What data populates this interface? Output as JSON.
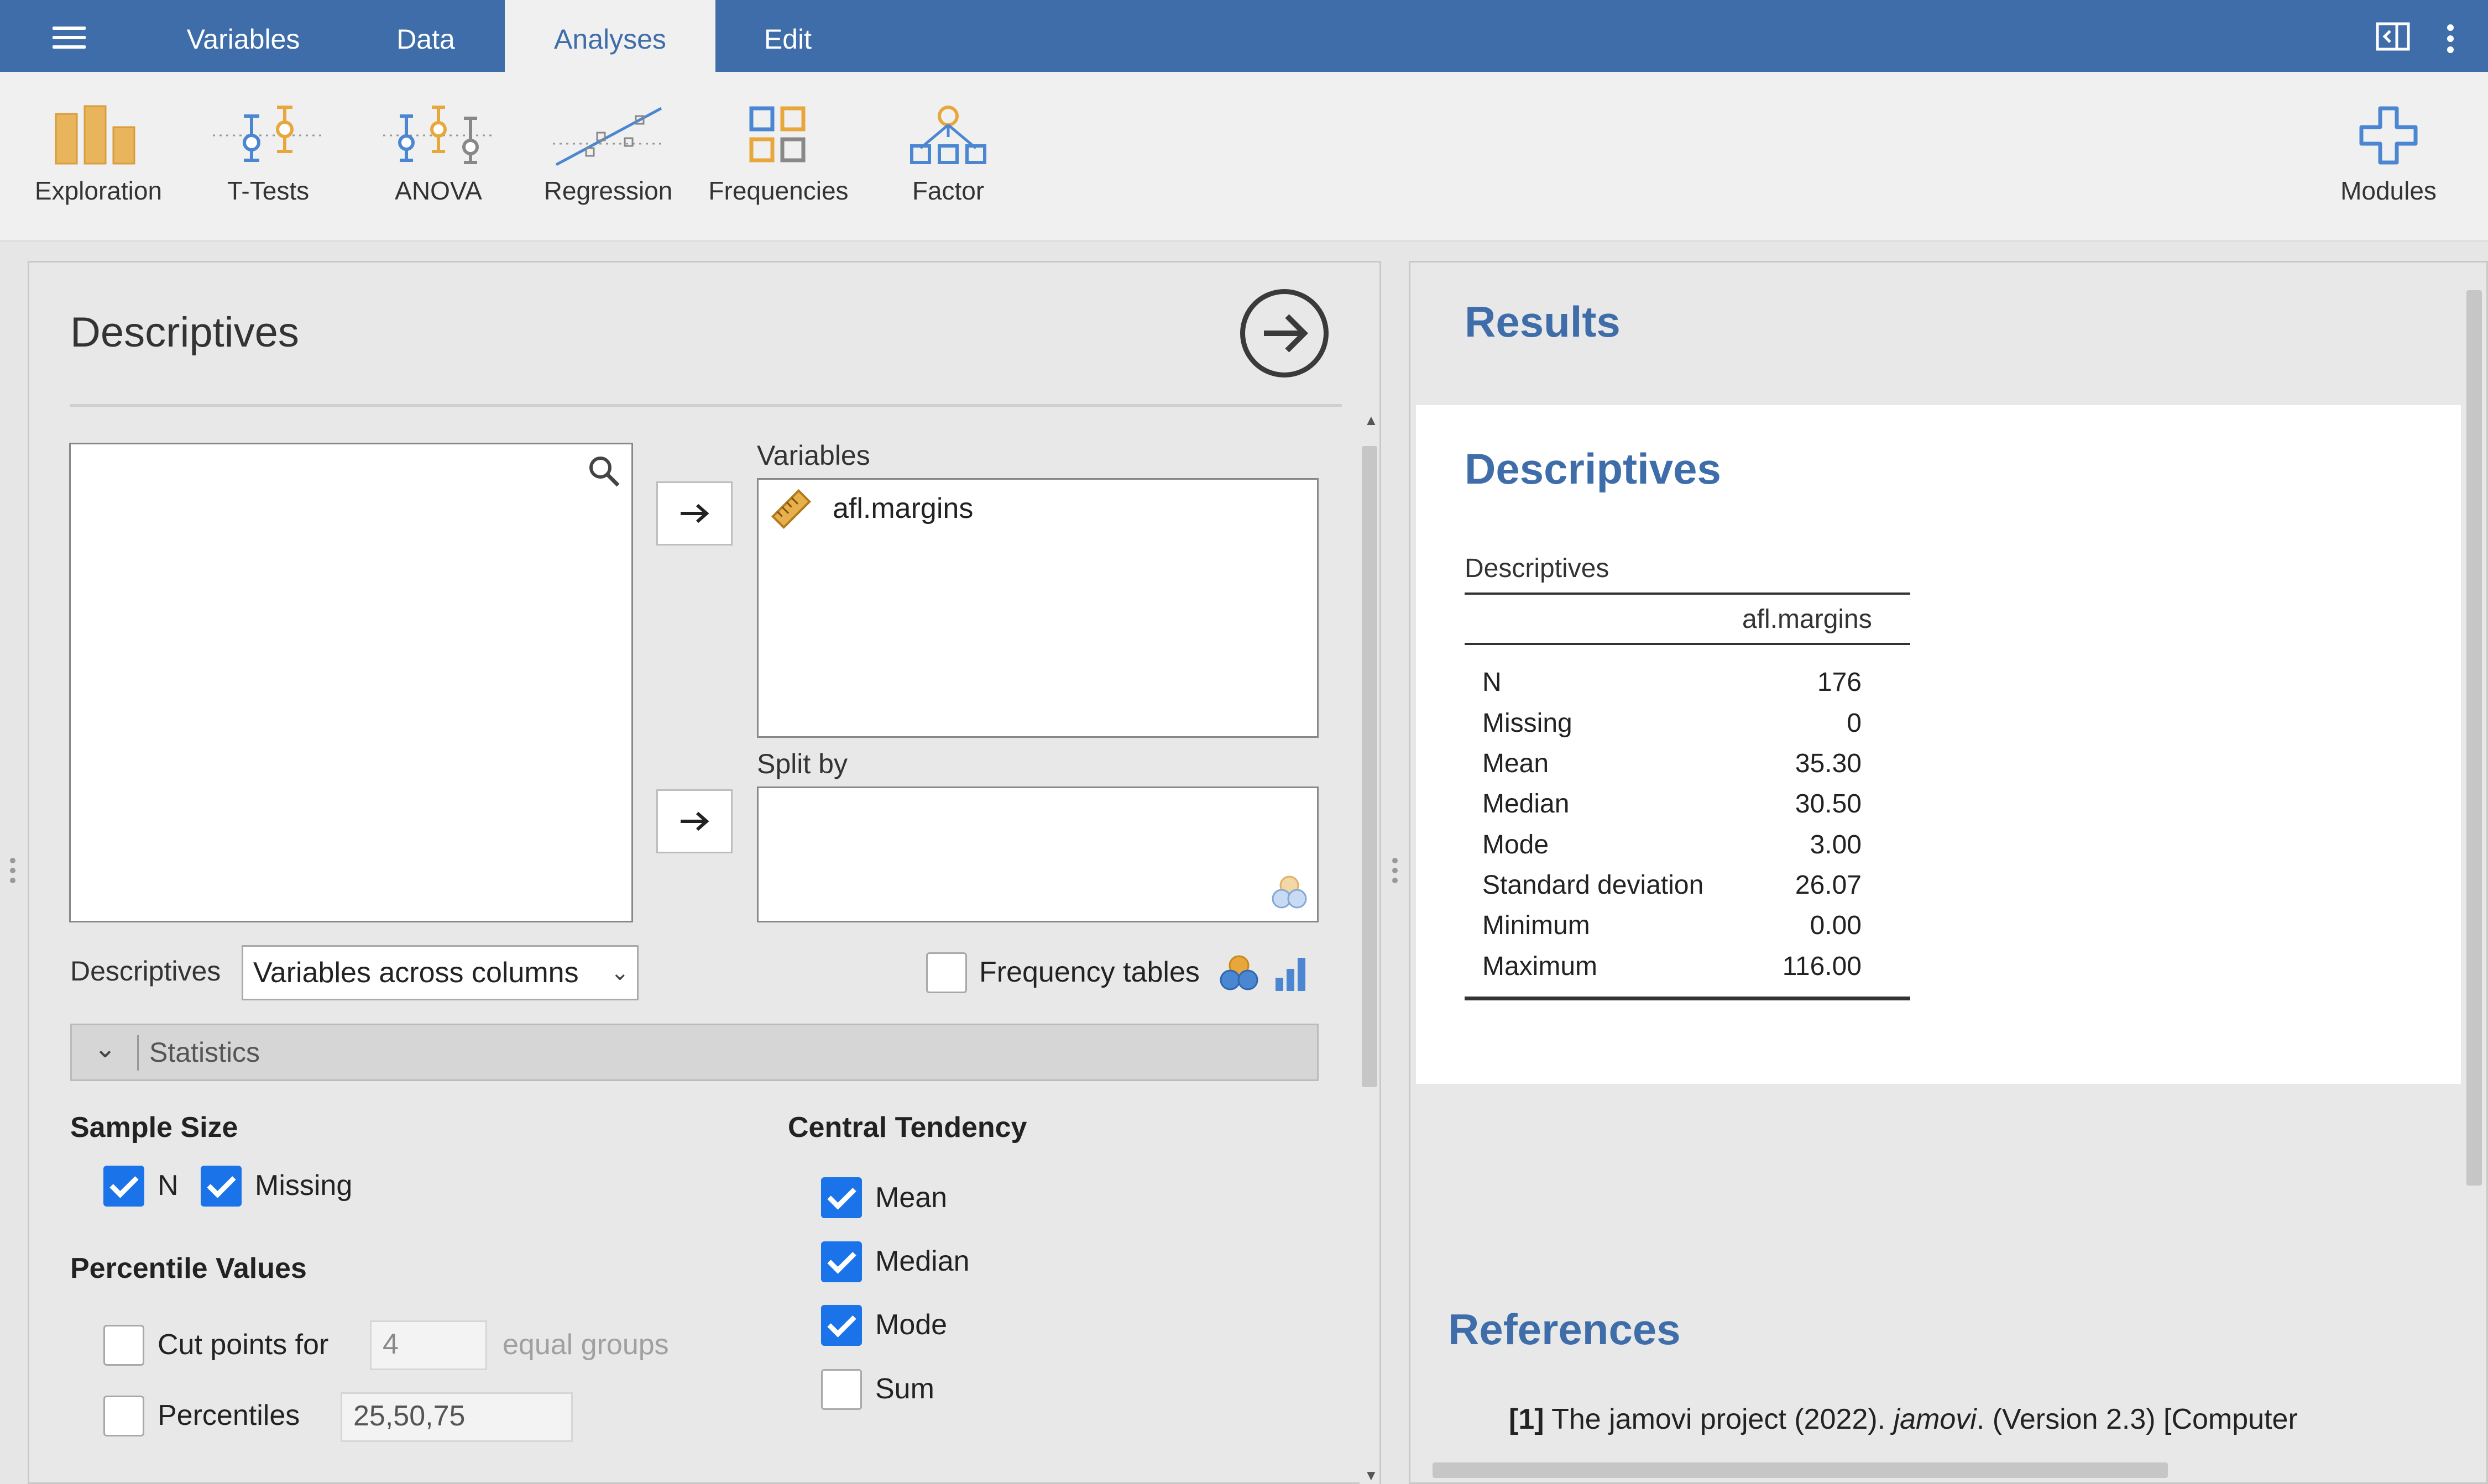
{
  "topbar": {
    "tabs": [
      "Variables",
      "Data",
      "Analyses",
      "Edit"
    ],
    "active_tab": "Analyses"
  },
  "ribbon": {
    "items": [
      "Exploration",
      "T-Tests",
      "ANOVA",
      "Regression",
      "Frequencies",
      "Factor"
    ],
    "modules_label": "Modules"
  },
  "options": {
    "title": "Descriptives",
    "variables_label": "Variables",
    "variables": [
      "afl.margins"
    ],
    "splitby_label": "Split by",
    "descriptives_label": "Descriptives",
    "descriptives_layout": "Variables across columns",
    "frequency_tables_label": "Frequency tables",
    "statistics_section": "Statistics",
    "sample_size": {
      "title": "Sample Size",
      "n_label": "N",
      "missing_label": "Missing"
    },
    "percentile_values": {
      "title": "Percentile Values",
      "cut_points_label": "Cut points for",
      "cut_points_value": "4",
      "equal_groups_label": "equal groups",
      "percentiles_label": "Percentiles",
      "percentiles_value": "25,50,75"
    },
    "central_tendency": {
      "title": "Central Tendency",
      "mean_label": "Mean",
      "median_label": "Median",
      "mode_label": "Mode",
      "sum_label": "Sum"
    }
  },
  "results": {
    "title": "Results",
    "section_title": "Descriptives",
    "table_title": "Descriptives",
    "column_header": "afl.margins",
    "rows": [
      {
        "label": "N",
        "value": "176"
      },
      {
        "label": "Missing",
        "value": "0"
      },
      {
        "label": "Mean",
        "value": "35.30"
      },
      {
        "label": "Median",
        "value": "30.50"
      },
      {
        "label": "Mode",
        "value": "3.00"
      },
      {
        "label": "Standard deviation",
        "value": "26.07"
      },
      {
        "label": "Minimum",
        "value": "0.00"
      },
      {
        "label": "Maximum",
        "value": "116.00"
      }
    ],
    "references_title": "References",
    "ref_number": "[1]",
    "ref_text_a": "The jamovi project (2022). ",
    "ref_text_italic": "jamovi",
    "ref_text_b": ". (Version 2.3) [Computer"
  },
  "colors": {
    "brand": "#3e6da9",
    "checkbox_on": "#1a73e8",
    "accent_orange": "#e8a73b"
  }
}
